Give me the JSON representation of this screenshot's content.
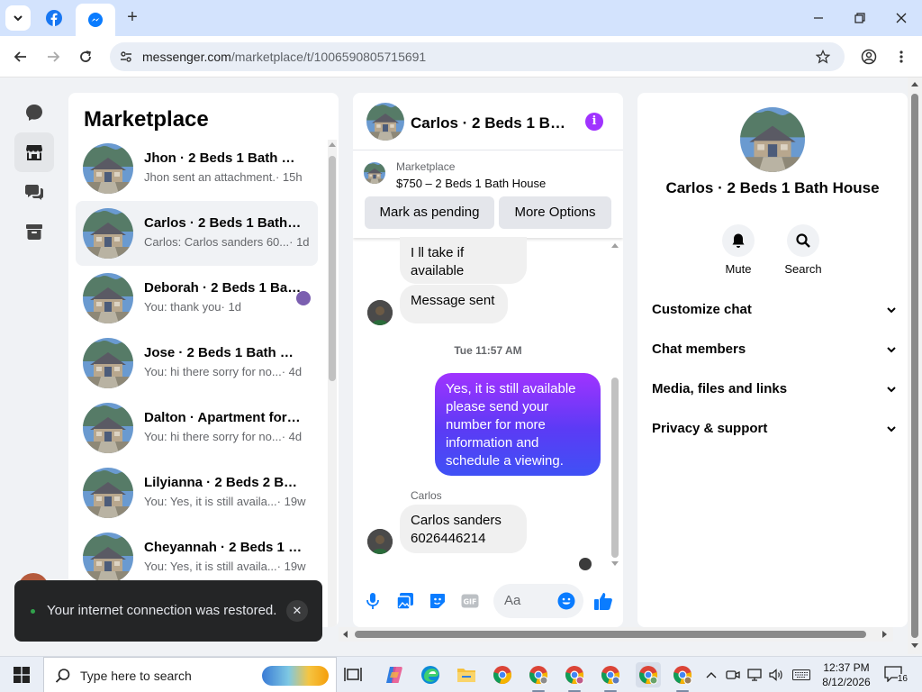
{
  "browser": {
    "url_host": "messenger.com",
    "url_path": "/marketplace/t/1006590805715691"
  },
  "list": {
    "title": "Marketplace",
    "conversations": [
      {
        "name": "Jhon · 2 Beds 1 Bath House",
        "preview": "Jhon sent an attachment.",
        "time": "· 15h",
        "active": false
      },
      {
        "name": "Carlos · 2 Beds 1 Bath House",
        "preview": "Carlos: Carlos sanders 60...",
        "time": "· 1d",
        "active": true
      },
      {
        "name": "Deborah · 2 Beds 1 Bath House",
        "preview": "You: thank you",
        "time": "· 1d",
        "active": false
      },
      {
        "name": "Jose · 2 Beds 1 Bath House",
        "preview": "You: hi there sorry for no...",
        "time": "· 4d",
        "active": false
      },
      {
        "name": "Dalton · Apartment for rent",
        "preview": "You: hi there sorry for no...",
        "time": "· 4d",
        "active": false
      },
      {
        "name": "Lilyianna · 2 Beds 2 Bath House",
        "preview": "You: Yes, it is still availa...",
        "time": "· 19w",
        "active": false
      },
      {
        "name": "Cheyannah · 2 Beds 1 Bath House",
        "preview": "You: Yes, it is still availa...",
        "time": "· 19w",
        "active": false
      }
    ]
  },
  "chat": {
    "title": "Carlos · 2 Beds 1 Bath House",
    "info_glyph": "i",
    "marketplace_label": "Marketplace",
    "listing": "$750 – 2 Beds 1 Bath House",
    "mark_pending": "Mark as pending",
    "more_options": "More Options",
    "messages": {
      "m1": "I ll take if available",
      "m2": "Message sent",
      "timestamp": "Tue 11:57 AM",
      "m3": "Yes, it is still available please send your number for more information and schedule a viewing.",
      "sender": "Carlos",
      "m4": "Carlos sanders 6026446214"
    },
    "composer_placeholder": "Aa"
  },
  "info": {
    "name": "Carlos · 2 Beds 1 Bath House",
    "mute": "Mute",
    "search": "Search",
    "sections": [
      "Customize chat",
      "Chat members",
      "Media, files and links",
      "Privacy & support"
    ]
  },
  "toast": {
    "message": "Your internet connection was restored.",
    "close": "✕"
  },
  "taskbar": {
    "search_placeholder": "Type here to search",
    "time": "12:37 PM",
    "date": "8/12/2026",
    "notifications": "16"
  },
  "colors": {
    "accent": "#a033ff",
    "bubble_gradient_end": "#3f51f5",
    "like": "#0a7cff"
  }
}
